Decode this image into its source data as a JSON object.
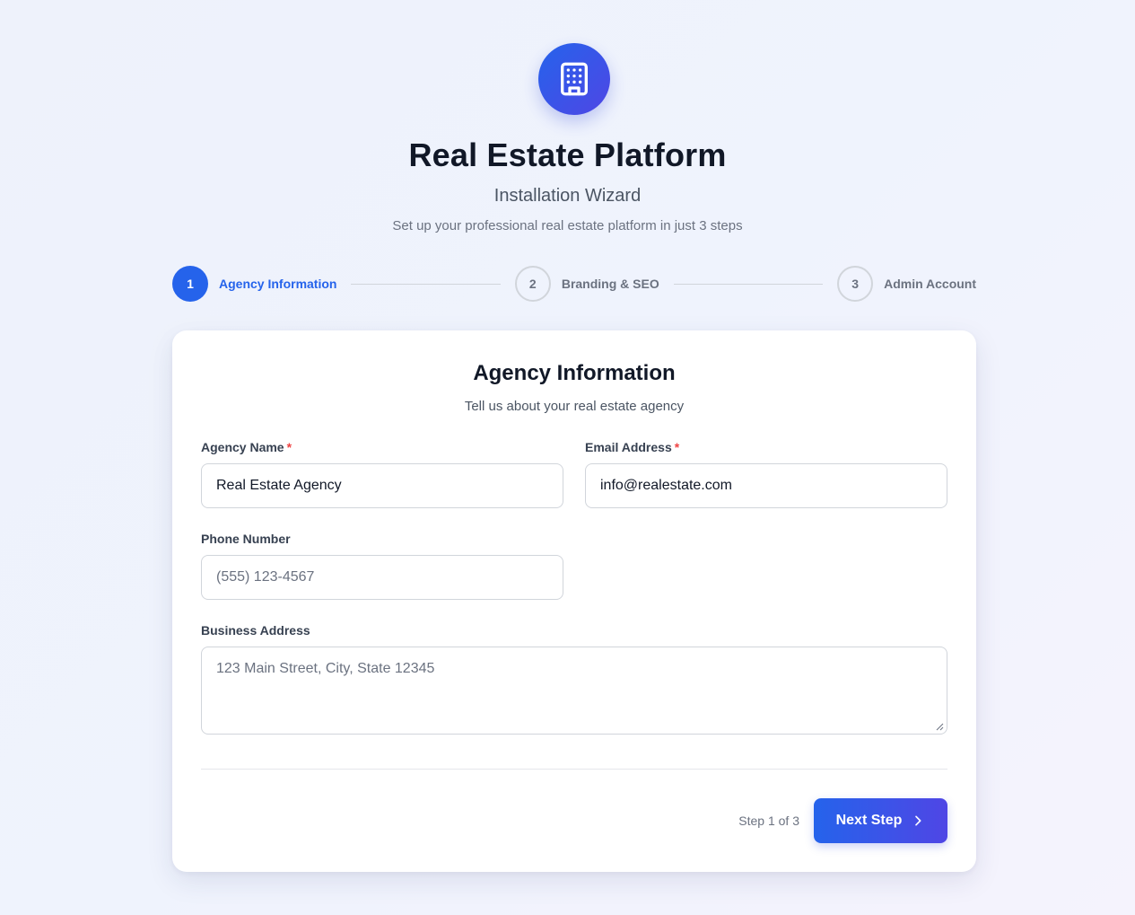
{
  "header": {
    "logo_icon": "building-icon",
    "title": "Real Estate Platform",
    "subtitle": "Installation Wizard",
    "tagline": "Set up your professional real estate platform in just 3 steps"
  },
  "steps": [
    {
      "number": "1",
      "label": "Agency Information",
      "state": "active"
    },
    {
      "number": "2",
      "label": "Branding & SEO",
      "state": "inactive"
    },
    {
      "number": "3",
      "label": "Admin Account",
      "state": "inactive"
    }
  ],
  "form": {
    "title": "Agency Information",
    "subtitle": "Tell us about your real estate agency",
    "agency_name": {
      "label": "Agency Name",
      "required_mark": "*",
      "value": "Real Estate Agency"
    },
    "email": {
      "label": "Email Address",
      "required_mark": "*",
      "value": "info@realestate.com"
    },
    "phone": {
      "label": "Phone Number",
      "placeholder": "(555) 123-4567",
      "value": ""
    },
    "address": {
      "label": "Business Address",
      "placeholder": "123 Main Street, City, State 12345",
      "value": ""
    }
  },
  "footer": {
    "step_counter": "Step 1 of 3",
    "next_label": "Next Step",
    "next_icon": "chevron-right-icon"
  },
  "colors": {
    "primary": "#2563eb",
    "primary_end": "#4f46e5",
    "required": "#ef4444"
  }
}
